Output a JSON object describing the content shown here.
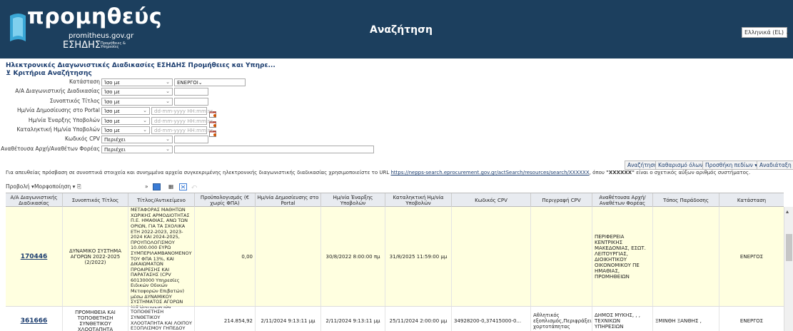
{
  "header": {
    "brand": "προμηθεύς",
    "domain": "promitheus.gov.gr",
    "esidis": "ΕΣΗΔΗΣ",
    "esidis_small": "Προμήθειες & Υπηρεσίες",
    "title": "Αναζήτηση",
    "language": "Ελληνικά (EL)"
  },
  "heading": "Ηλεκτρονικές Διαγωνιστικές Διαδικασίες ΕΣΗΔΗΣ Προμήθειες και Υπηρε...",
  "criteria_title": "Κριτήρια Αναζήτησης",
  "criteria": [
    {
      "label": "Κατάσταση",
      "op": "Ίσο με",
      "value": "ΕΝΕΡΓΟΙ"
    },
    {
      "label": "Α/Α Διαγωνιστικής Διαδικασίας",
      "op": "Ίσο με",
      "value": ""
    },
    {
      "label": "Συνοπτικός Τίτλος",
      "op": "Ίσο με",
      "value": ""
    },
    {
      "label": "Ημ/νία Δημοσίευσης στο Portal",
      "op": "Ίσο με",
      "value": "dd-mm-yyyy HH:mm:ss"
    },
    {
      "label": "Ημ/νία Έναρξης Υποβολών",
      "op": "Ίσο με",
      "value": "dd-mm-yyyy HH:mm:ss"
    },
    {
      "label": "Καταληκτική Ημ/νία Υποβολών",
      "op": "Ίσο με",
      "value": "dd-mm-yyyy HH:mm:ss"
    },
    {
      "label": "Κωδικός CPV",
      "op": "Περιέχει",
      "value": ""
    },
    {
      "label": "Αναθέτουσα Αρχή/Αναθέτων Φορέας",
      "op": "Περιέχει",
      "value": ""
    }
  ],
  "actions": {
    "search": "Αναζήτηση",
    "clear": "Καθαρισμό όλων",
    "add_fields": "Προσθήκη πεδίων",
    "reorder": "Αναδιάταξη"
  },
  "info": {
    "before": "Για απευθείας πρόσβαση σε συνοπτικά στοιχεία και συνημμένα αρχεία συγκεκριμένης ηλεκτρονικής διαγωνιστικής διαδικασίας χρησιμοποιείστε το URL ",
    "url": "https://nepps-search.eprocurement.gov.gr/actSearch/resources/search/XXXXXX",
    "middle": ", όπου ",
    "token": "\"XXXXXX\"",
    "after": " είναι ο σχετικός αύξων αριθμός συστήματος."
  },
  "toolbar": {
    "view": "Προβολή",
    "format": "Μορφοποίηση"
  },
  "columns": {
    "aa": "Α/Α Διαγωνιστικής Διαδικασίας",
    "title": "Συνοπτικός Τίτλος",
    "subject": "Τίτλος/Αντικείμενο",
    "budget": "Προϋπολογισμός (€ χωρίς ΦΠΑ)",
    "pub": "Ημ/νία Δημοσίευσης στο Portal",
    "start": "Ημ/νία Έναρξης Υποβολών",
    "end": "Καταληκτική Ημ/νία Υποβολών",
    "cpv": "Κωδικός CPV",
    "cpv_desc": "Περιγραφή CPV",
    "authority": "Αναθέτουσα Αρχή/ Αναθέτων Φορέας",
    "place": "Τόπος Παράδοσης",
    "status": "Κατάσταση"
  },
  "rows": [
    {
      "aa": "170446",
      "title": "ΔΥΝΑΜΙΚΟ ΣΥΣΤΗΜΑ ΑΓΟΡΩΝ 2022-2025 (2/2022)",
      "subject": "ΔΙΑΚΗΡΥΞΗ ΓΙΑ ΤΗΝ ΑΝΑΘΕΣΗ ΥΠΗΡΕΣΙΩΝ ΜΕΤΑΦΟΡΑΣ ΜΑΘΗΤΩΝ ΧΩΡΙΚΗΣ ΑΡΜΟΔΙΟΤΗΤΑΣ Π.Ε. ΗΜΑΘΙΑΣ, ΑΝΩ ΤΩΝ ΟΡΙΩΝ, ΓΙΑ ΤΑ ΣΧΟΛΙΚΑ ΕΤΗ 2022-2023, 2023-2024 ΚΑΙ 2024-2025, ΠΡΟΥΠΟΛΟΓΙΣΜΟΥ 10.000.000 ΕΥΡΩ ΣΥΜΠΕΡΙΛΑΜΒΑΝΟΜΕΝΟΥ ΤΟΥ ΦΠΑ 13%, ΚΑΙ ΔΙΚΑΙΩΜΑΤΩΝ ΠΡΟΑΙΡΕΣΗΣ ΚΑΙ ΠΑΡΑΤΑΣΗΣ (CPV 60130000 Υπηρεσίες Ειδικών Οδικών Μεταφορών Επιβατών) μέσω ΔΥΝΑΜΙΚΟΥ ΣΥΣΤΗΜΑΤΟΣ ΑΓΟΡΩΝ (ΔΣΑ) με τη χρήση του ΕΣΗΔΗΣ",
      "budget": "0,00",
      "pub": "",
      "start": "30/8/2022 8:00:00 πμ",
      "end": "31/8/2025 11:59:00 μμ",
      "cpv": "",
      "cpv_desc": "",
      "authority": "ΠΕΡΙΦΕΡΕΙΑ ΚΕΝΤΡΙΚΗΣ ΜΑΚΕΔΟΝΙΑΣ, ΕΣΩΤ. ΛΕΙΤΟΥΡΓΙΑΣ, ΔΙΟΙΚΗΤΙΚΟΥ ΟΙΚΟΝΟΜΙΚΟΥ ΠΕ ΗΜΑΘΙΑΣ, ΠΡΟΜΗΘΕΙΩΝ",
      "place": "",
      "status": "ΕΝΕΡΓΟΣ"
    },
    {
      "aa": "361666",
      "title": "ΠΡΟΜΗΘΕΙΑ ΚΑΙ ΤΟΠΟΘΕΤΗΣΗ ΣΥΝΘΕΤΙΚΟΥ ΧΛΟΟΤΑΠΗΤΑ",
      "subject": "«ΠΡΟΜΗΘΕΙΑ ΚΑΙ ΤΟΠΟΘΕΤΗΣΗ ΣΥΝΘΕΤΙΚΟΥ ΧΛΟΟΤΑΠΗΤΑ ΚΑΙ ΛΟΙΠΟΥ ΕΞΟΠΛΙΣΜΟΥ ΓΗΠΕΔΟΥ ΟΙΚΙΣΜΟΥ ΚΕΝΤΑΥΡΟΥ»",
      "budget": "214.854,92",
      "pub": "2/11/2024 9:13:11 μμ",
      "start": "2/11/2024 9:13:11 μμ",
      "end": "25/11/2024 2:00:00 μμ",
      "cpv": "34928200-0,37415000-0...",
      "cpv_desc": "Αθλητικός εξοπλισμός,Περιφράξεις,... χορτοτάπητας",
      "authority": "ΔΗΜΟΣ ΜΥΚΗΣ, , , ΤΕΧΝΙΚΩΝ ΥΠΗΡΕΣΙΩΝ",
      "place": "ΞΜΙΝΘΗ ΞΑΝΘΗΣ ,",
      "status": "ΕΝΕΡΓΟΣ"
    }
  ],
  "colors": {
    "header_bg": "#1c3f5e",
    "accent": "#1a3c6e",
    "row_highlight": "#ffffe0"
  }
}
